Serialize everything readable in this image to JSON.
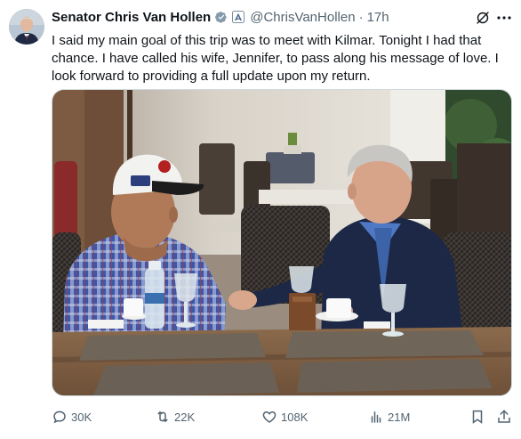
{
  "author": {
    "display_name": "Senator Chris Van Hollen",
    "handle": "@ChrisVanHollen",
    "timestamp": "17h",
    "verified_badge": "gray-check-badge-icon",
    "affiliation_badge": "us-government-flag-icon"
  },
  "tweet": {
    "text": "I said my main goal of this trip was to meet with Kilmar. Tonight I had that chance. I have called his wife, Jennifer, to pass along his message of love. I look forward to providing a full update upon my return."
  },
  "media": {
    "type": "photo"
  },
  "actions": {
    "reply_count": "30K",
    "repost_count": "22K",
    "like_count": "108K",
    "view_count": "21M"
  },
  "colors": {
    "text_primary": "#0f1419",
    "text_secondary": "#536471",
    "verified_gray": "#829aab",
    "gov_badge": "#7c8fa3"
  }
}
